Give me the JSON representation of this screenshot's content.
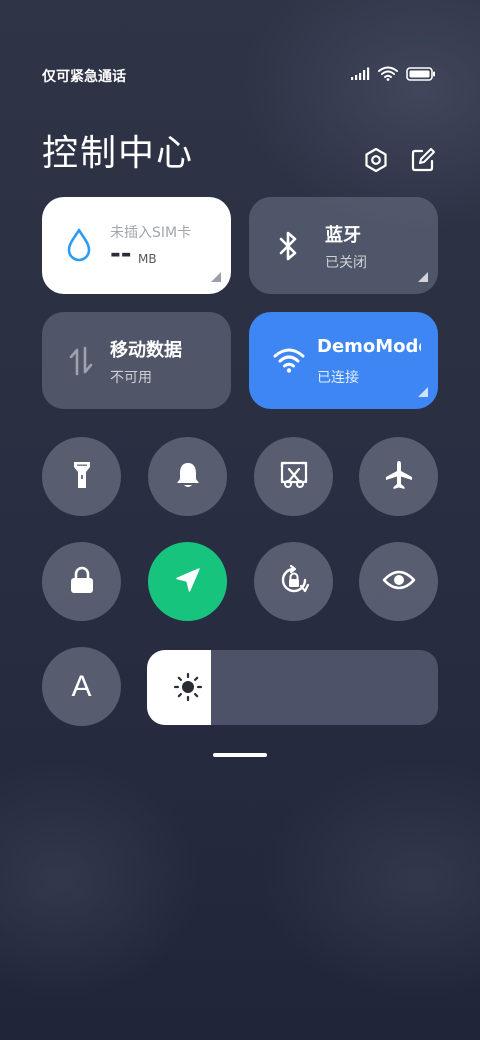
{
  "status_bar": {
    "carrier_text": "仅可紧急通话",
    "icons": [
      "signal-icon",
      "wifi-icon",
      "battery-icon"
    ]
  },
  "header": {
    "title": "控制中心",
    "settings_icon": "settings-icon",
    "edit_icon": "edit-icon"
  },
  "tiles": {
    "data_usage": {
      "label": "未插入SIM卡",
      "value": "--",
      "unit": "MB",
      "icon": "water-drop-icon"
    },
    "bluetooth": {
      "label": "蓝牙",
      "status": "已关闭",
      "icon": "bluetooth-icon"
    },
    "mobile_data": {
      "label": "移动数据",
      "status": "不可用",
      "icon": "mobile-data-icon"
    },
    "wifi": {
      "label": "DemoMode",
      "status": "已连接",
      "icon": "wifi-icon",
      "color": "#3f86f5"
    }
  },
  "toggles": {
    "row1": [
      "flashlight-icon",
      "bell-icon",
      "screenshot-icon",
      "airplane-icon"
    ],
    "row2": [
      "lock-icon",
      "location-icon",
      "rotation-lock-icon",
      "eye-icon"
    ],
    "font": "A",
    "location_color": "#17c47e"
  },
  "brightness": {
    "level": 0.22,
    "icon": "brightness-icon"
  }
}
